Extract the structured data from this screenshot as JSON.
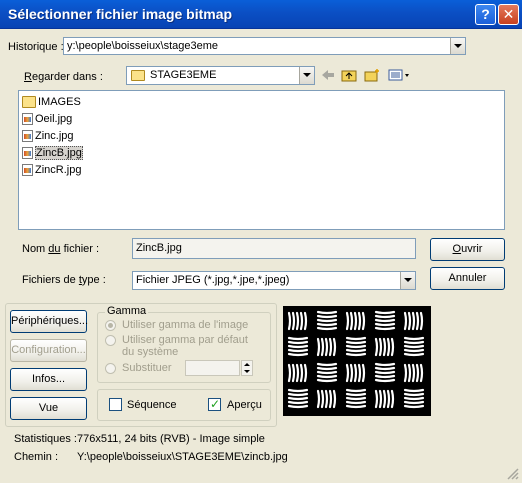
{
  "window": {
    "title": "Sélectionner fichier image bitmap",
    "help_glyph": "?",
    "close_glyph": "✕"
  },
  "history": {
    "label": "Historique :",
    "value": "y:\\people\\boisseiux\\stage3eme"
  },
  "look_in": {
    "label_accel": "R",
    "label_rest": "egarder dans :",
    "value": "STAGE3EME"
  },
  "files": [
    {
      "name": "IMAGES",
      "kind": "folder"
    },
    {
      "name": "Oeil.jpg",
      "kind": "file"
    },
    {
      "name": "Zinc.jpg",
      "kind": "file"
    },
    {
      "name": "ZincB.jpg",
      "kind": "file",
      "selected": true
    },
    {
      "name": "ZincR.jpg",
      "kind": "file"
    }
  ],
  "filename": {
    "label_pre": "Nom ",
    "label_accel": "du",
    "label_post": " fichier :",
    "value": "ZincB.jpg"
  },
  "filetype": {
    "label_pre": "Fichiers de ",
    "label_accel": "t",
    "label_post": "ype :",
    "value": "Fichier JPEG (*.jpg,*.jpe,*.jpeg)"
  },
  "buttons": {
    "open_accel": "O",
    "open_rest": "uvrir",
    "cancel": "Annuler",
    "devices": "Périphériques...",
    "config": "Configuration...",
    "info": "Infos...",
    "view": "Vue"
  },
  "gamma": {
    "title": "Gamma",
    "opt1": "Utiliser gamma de l'image",
    "opt2_line1": "Utiliser gamma par défaut",
    "opt2_line2": "du système",
    "opt3": "Substituer"
  },
  "sequence": {
    "label": "Séquence",
    "checked": false
  },
  "preview": {
    "label": "Aperçu",
    "checked": true
  },
  "stats": {
    "label": "Statistiques :",
    "value": "776x511, 24 bits (RVB) - Image simple"
  },
  "path": {
    "label": "Chemin :",
    "value": "Y:\\people\\boisseiux\\STAGE3EME\\zincb.jpg"
  }
}
